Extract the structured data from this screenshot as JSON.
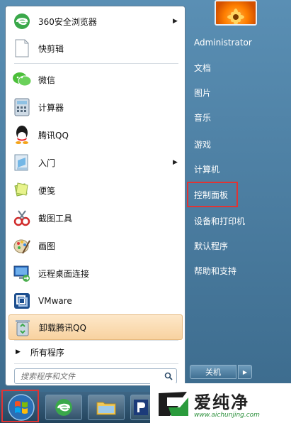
{
  "programs": [
    {
      "label": "360安全浏览器",
      "icon": "360-browser-icon",
      "has_arrow": true
    },
    {
      "label": "快剪辑",
      "icon": "kuaijianji-icon",
      "has_arrow": false
    },
    {
      "label": "微信",
      "icon": "wechat-icon",
      "has_arrow": false
    },
    {
      "label": "计算器",
      "icon": "calculator-icon",
      "has_arrow": false
    },
    {
      "label": "腾讯QQ",
      "icon": "qq-icon",
      "has_arrow": false
    },
    {
      "label": "入门",
      "icon": "getting-started-icon",
      "has_arrow": true
    },
    {
      "label": "便笺",
      "icon": "sticky-notes-icon",
      "has_arrow": false
    },
    {
      "label": "截图工具",
      "icon": "snipping-tool-icon",
      "has_arrow": false
    },
    {
      "label": "画图",
      "icon": "paint-icon",
      "has_arrow": false
    },
    {
      "label": "远程桌面连接",
      "icon": "remote-desktop-icon",
      "has_arrow": false
    },
    {
      "label": "VMware",
      "icon": "vmware-icon",
      "has_arrow": false
    },
    {
      "label": "卸载腾讯QQ",
      "icon": "recycle-bin-icon",
      "has_arrow": false
    }
  ],
  "arrow_glyph": "▶",
  "all_programs": {
    "label": "所有程序",
    "glyph": "▶"
  },
  "search": {
    "placeholder": "搜索程序和文件"
  },
  "right_items": [
    {
      "label": "Administrator"
    },
    {
      "label": "文档"
    },
    {
      "label": "图片"
    },
    {
      "label": "音乐"
    },
    {
      "label": "游戏"
    },
    {
      "label": "计算机"
    },
    {
      "label": "控制面板"
    },
    {
      "label": "设备和打印机"
    },
    {
      "label": "默认程序"
    },
    {
      "label": "帮助和支持"
    }
  ],
  "shutdown": {
    "label": "关机",
    "arrow": "▶"
  },
  "watermark": {
    "brand": "爱纯净",
    "url": "www.aichunjing.com"
  },
  "colors": {
    "highlight_box": "#e03434",
    "watermark_green": "#2a8f3a"
  }
}
